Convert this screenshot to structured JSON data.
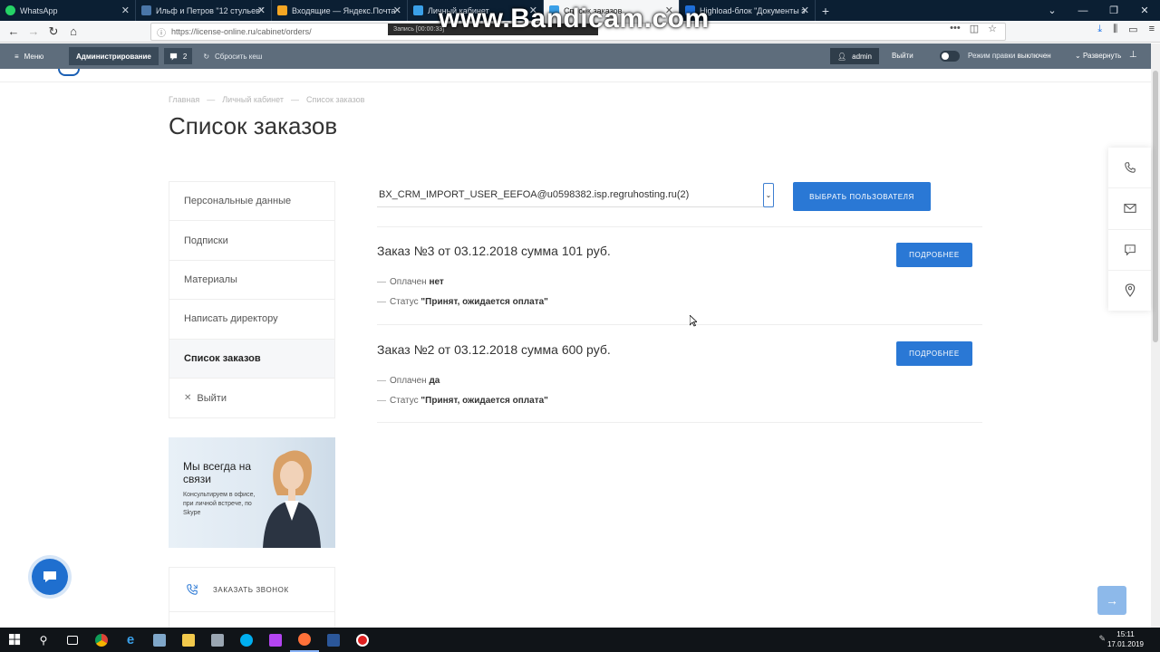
{
  "browser": {
    "tabs": [
      {
        "label": "WhatsApp",
        "color": "#25d366"
      },
      {
        "label": "Ильф и Петров \"12 стульев\"",
        "color": "#4a76a8"
      },
      {
        "label": "Входящие — Яндекс.Почта",
        "color": "#f5a623"
      },
      {
        "label": "Личный кабинет",
        "color": "#3aa0e8"
      },
      {
        "label": "Список заказов",
        "color": "#3aa0e8"
      },
      {
        "label": "Highload-блок \"Документы э",
        "color": "#1e6fd9"
      }
    ],
    "url": "https://license-online.ru/cabinet/orders/",
    "watermark": "www.Bandicam.com",
    "recording": "Запись [00:00:33]"
  },
  "admin_panel": {
    "menu_label": "Меню",
    "admin_tab": "Администрирование",
    "notifications_count": "2",
    "clear_cache": "Сбросить кеш",
    "user": "admin",
    "logout": "Выйти",
    "edit_mode_label": "Режим правки",
    "edit_mode_value": "выключен",
    "expand": "Развернуть"
  },
  "breadcrumb": [
    "Главная",
    "—",
    "Личный кабинет",
    "—",
    "Список заказов"
  ],
  "page_title": "Список заказов",
  "sidebar": {
    "items": [
      {
        "label": "Персональные данные"
      },
      {
        "label": "Подписки"
      },
      {
        "label": "Материалы"
      },
      {
        "label": "Написать директору"
      },
      {
        "label": "Список заказов"
      },
      {
        "label": "Выйти"
      }
    ]
  },
  "promo": {
    "title": "Мы всегда на связи",
    "text": "Консультируем в офисе, при личной встрече, по Skype"
  },
  "callback_label": "ЗАКАЗАТЬ ЗВОНОК",
  "user_select": {
    "value": "BX_CRM_IMPORT_USER_EEFOA@u0598382.isp.regruhosting.ru(2)",
    "button": "ВЫБРАТЬ ПОЛЬЗОВАТЕЛЯ"
  },
  "orders": [
    {
      "title": "Заказ №3 от 03.12.2018 сумма 101 руб.",
      "paid_label": "Оплачен",
      "paid_value": "нет",
      "status_label": "Статус",
      "status_value": "\"Принят, ожидается оплата\"",
      "button": "ПОДРОБНЕЕ"
    },
    {
      "title": "Заказ №2 от 03.12.2018 сумма 600 руб.",
      "paid_label": "Оплачен",
      "paid_value": "да",
      "status_label": "Статус",
      "status_value": "\"Принят, ожидается оплата\"",
      "button": "ПОДРОБНЕЕ"
    }
  ],
  "taskbar": {
    "time": "15:11",
    "date": "17.01.2019"
  },
  "colors": {
    "accent": "#2a78d5",
    "admin_bar": "#5e6d7c",
    "tab_strip": "#0b1f33"
  }
}
